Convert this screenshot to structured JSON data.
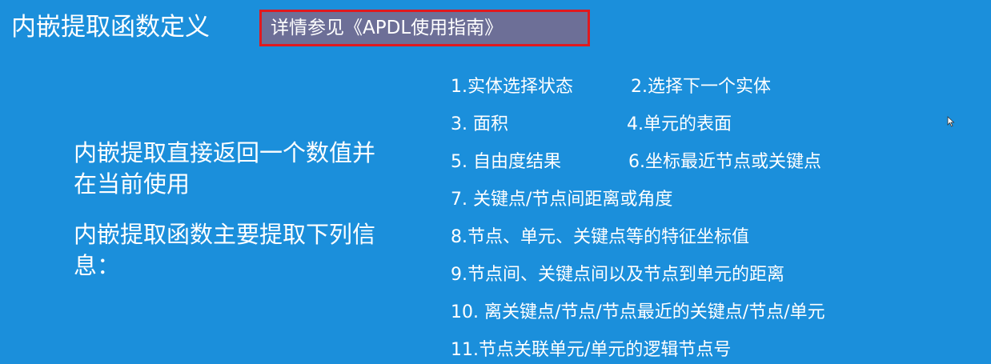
{
  "slide": {
    "title": "内嵌提取函数定义",
    "reference": "详情参见《APDL使用指南》",
    "left_paragraphs": [
      "内嵌提取直接返回一个数值并在当前使用",
      "内嵌提取函数主要提取下列信息："
    ],
    "items": [
      {
        "a": "1.实体选择状态",
        "b": "2.选择下一个实体"
      },
      {
        "a": "3. 面积",
        "b": "4.单元的表面"
      },
      {
        "a": "5. 自由度结果",
        "b": "6.坐标最近节点或关键点"
      },
      {
        "a": "7. 关键点/节点间距离或角度",
        "b": ""
      },
      {
        "a": "8.节点、单元、关键点等的特征坐标值",
        "b": ""
      },
      {
        "a": "9.节点间、关键点间以及节点到单元的距离",
        "b": ""
      },
      {
        "a": "10. 离关键点/节点/节点最近的关键点/节点/单元",
        "b": ""
      },
      {
        "a": "11.节点关联单元/单元的逻辑节点号",
        "b": ""
      }
    ]
  },
  "colors": {
    "background": "#1b8fdb",
    "text": "#ffffff",
    "reference_fill": "#6d6f97",
    "reference_border": "#e0191e"
  },
  "icons": {
    "cursor": "mouse-pointer-icon"
  }
}
